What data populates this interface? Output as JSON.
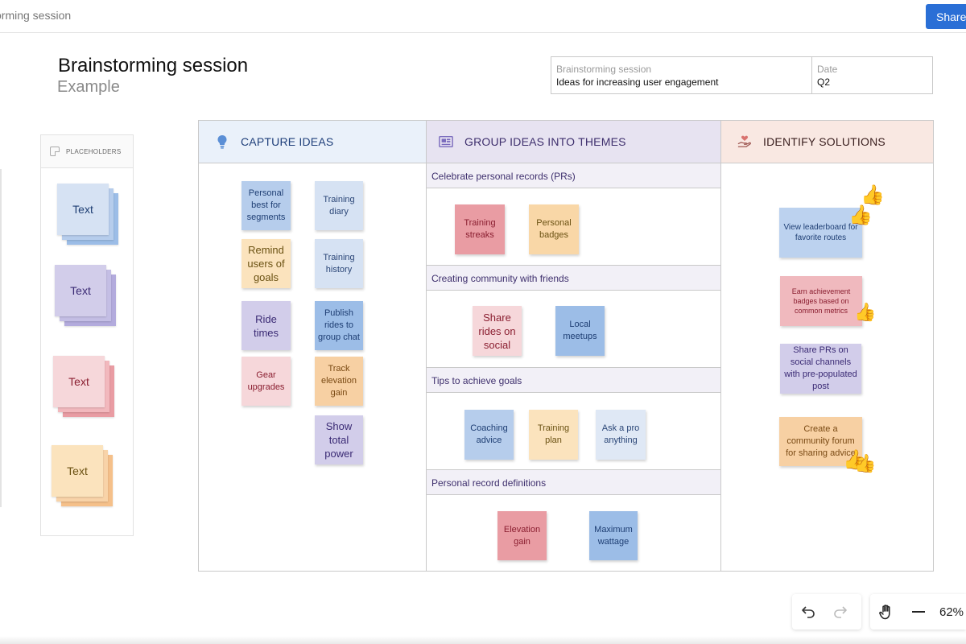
{
  "topbar": {
    "doc_title": "orming session",
    "share_label": "Share"
  },
  "page": {
    "title": "Brainstorming session",
    "subtitle": "Example"
  },
  "info": {
    "left_label": "Brainstorming session",
    "left_value": "Ideas for increasing user engagement",
    "right_label": "Date",
    "right_value": "Q2"
  },
  "placeholders": {
    "header": "PLACEHOLDERS",
    "items": [
      {
        "label": "Text",
        "color": "blue"
      },
      {
        "label": "Text",
        "color": "lavender"
      },
      {
        "label": "Text",
        "color": "pink"
      },
      {
        "label": "Text",
        "color": "orange"
      }
    ]
  },
  "columns": {
    "capture": {
      "title": "CAPTURE IDEAS",
      "icon": "lightbulb-icon",
      "color": "#eaf1fa"
    },
    "group": {
      "title": "GROUP IDEAS INTO THEMES",
      "icon": "image-frame-icon",
      "color": "#e7e3f1"
    },
    "solutions": {
      "title": "IDENTIFY SOLUTIONS",
      "icon": "heart-hand-icon",
      "color": "#f9e8e2"
    }
  },
  "capture_notes": [
    "Personal best for segments",
    "Training diary",
    "Remind users of goals",
    "Training history",
    "Ride times",
    "Publish rides to group chat",
    "Gear upgrades",
    "Track elevation gain",
    "Show total power"
  ],
  "themes": [
    {
      "title": "Celebrate personal records (PRs)",
      "notes": [
        "Training streaks",
        "Personal badges"
      ]
    },
    {
      "title": "Creating community with friends",
      "notes": [
        "Share rides on social",
        "Local meetups"
      ]
    },
    {
      "title": "Tips to achieve goals",
      "notes": [
        "Coaching advice",
        "Training plan",
        "Ask a pro anything"
      ]
    },
    {
      "title": "Personal record definitions",
      "notes": [
        "Elevation gain",
        "Maximum wattage"
      ]
    }
  ],
  "solutions": [
    "View leaderboard for favorite routes",
    "Earn achievement badges based on common metrics",
    "Share PRs on social channels with pre-populated post",
    "Create a community forum for sharing advice"
  ],
  "reactions": {
    "thumbs_up": "👍"
  },
  "toolbar": {
    "zoom": "62%"
  }
}
